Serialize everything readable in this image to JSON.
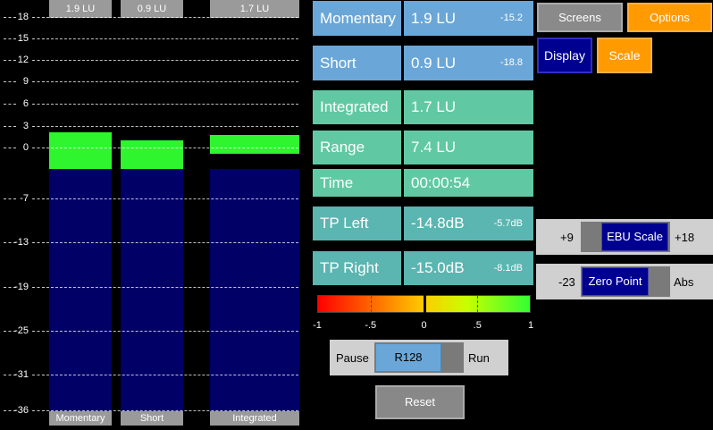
{
  "scale": {
    "ticks": [
      "18",
      "15",
      "12",
      "9",
      "6",
      "3",
      "0",
      "-7",
      "-13",
      "-19",
      "-25",
      "-31",
      "-36"
    ]
  },
  "meters": [
    {
      "top_label": "1.9 LU",
      "bottom_label": "Momentary",
      "value_lu": 1.9,
      "peak_lu": 2.1
    },
    {
      "top_label": "0.9 LU",
      "bottom_label": "Short",
      "value_lu": 0.9,
      "peak_lu": 1.0
    },
    {
      "top_label": "1.7 LU",
      "bottom_label": "Integrated",
      "value_lu": 1.7,
      "peak_lu": 1.7
    }
  ],
  "readouts": [
    {
      "label": "Momentary",
      "value": "1.9 LU",
      "secondary": "-15.2"
    },
    {
      "label": "Short",
      "value": "0.9 LU",
      "secondary": "-18.8"
    },
    {
      "label": "Integrated",
      "value": "1.7 LU",
      "secondary": ""
    },
    {
      "label": "Range",
      "value": "7.4 LU",
      "secondary": ""
    },
    {
      "label": "Time",
      "value": "00:00:54",
      "secondary": ""
    },
    {
      "label": "TP Left",
      "value": "-14.8dB",
      "secondary": "-5.7dB"
    },
    {
      "label": "TP Right",
      "value": "-15.0dB",
      "secondary": "-8.1dB"
    }
  ],
  "correlation": {
    "labels": [
      "-1",
      "-.5",
      "0",
      ".5",
      "1"
    ],
    "value": 0.0
  },
  "buttons": {
    "screens": "Screens",
    "options": "Options",
    "display": "Display",
    "scale": "Scale",
    "reset": "Reset"
  },
  "ebu_scale": {
    "left": "+9",
    "knob": "EBU Scale",
    "right": "+18"
  },
  "zero_point": {
    "left": "-23",
    "knob": "Zero Point",
    "right": "Abs"
  },
  "mode": {
    "left": "Pause",
    "knob": "R128",
    "right": "Run"
  },
  "colors": {
    "meter_blue": "#000066",
    "meter_green": "#2ef52e",
    "accent_orange": "#ff9a00",
    "navy": "#000090"
  }
}
